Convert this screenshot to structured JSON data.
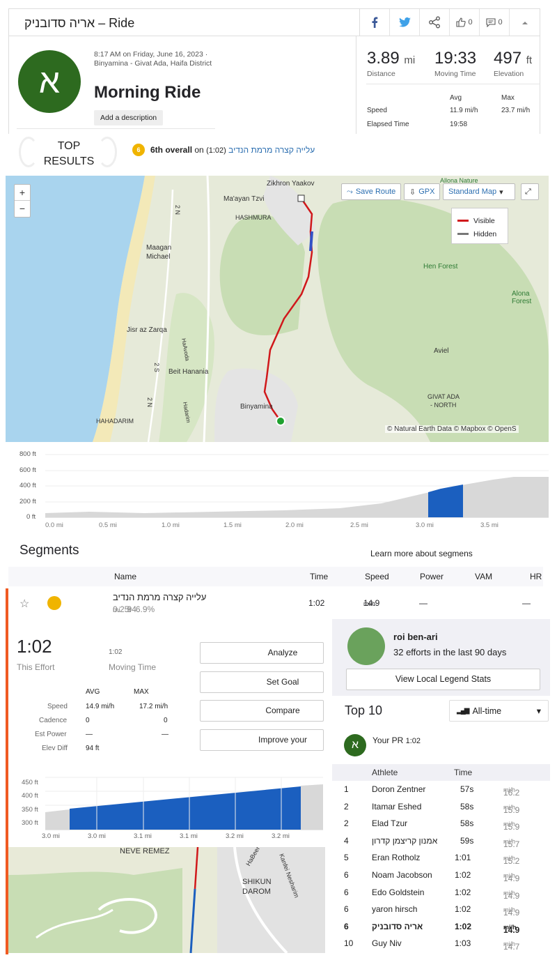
{
  "header": {
    "title": "אריה סדובניק – Ride",
    "kudos_count": "0",
    "comment_count": "0"
  },
  "activity": {
    "avatar_letter": "א",
    "datetime": "8:17 AM on Friday, June 16, 2023 ·",
    "location": "Binyamina - Givat Ada, Haifa District",
    "name": "Morning Ride",
    "add_description": "Add a description"
  },
  "stats": {
    "distance": {
      "value": "3.89",
      "unit": "mi",
      "label": "Distance"
    },
    "moving_time": {
      "value": "19:33",
      "label": "Moving Time"
    },
    "elevation": {
      "value": "497",
      "unit": "ft",
      "label": "Elevation"
    },
    "avg_label": "Avg",
    "max_label": "Max",
    "speed_label": "Speed",
    "speed_avg": "11.9 mi/h",
    "speed_max": "23.7 mi/h",
    "elapsed_label": "Elapsed Time",
    "elapsed": "19:58"
  },
  "top_results": {
    "badge": "TOP RESULTS",
    "rank_icon": "6",
    "text": "6th overall",
    "on": "on",
    "segment": "עלייה קצרה מרמת הנדיב",
    "time": "(1:02)"
  },
  "map": {
    "zoom_in": "+",
    "zoom_out": "−",
    "save_route": "Save Route",
    "gpx": "GPX",
    "map_type": "Standard Map",
    "legend_visible": "Visible",
    "legend_hidden": "Hidden",
    "attribution": "© Natural Earth Data © Mapbox © OpenS",
    "places": [
      "Zikhron Yaakov",
      "Ma'ayan Tzvi",
      "HASHMURA",
      "Maagan",
      "Michael",
      "Jisr az Zarqa",
      "Beit Hanania",
      "Binyamina",
      "HAHADARIM",
      "Hen Forest",
      "Alona Forest",
      "Aviel",
      "GIVAT ADA",
      "- NORTH",
      "Allona Nature",
      "2 N",
      "2 S",
      "2 N",
      "Hadarim",
      "HaAvoda"
    ],
    "colors": {
      "visible": "#d0181b",
      "hidden": "#777777",
      "segment": "#3351c6",
      "water": "#a9d4ee",
      "green": "#c8ddb4"
    }
  },
  "elevation_chart": {
    "y_ticks": [
      "800 ft",
      "600 ft",
      "400 ft",
      "200 ft",
      "0 ft"
    ],
    "x_ticks": [
      "0.0 mi",
      "0.5 mi",
      "1.0 mi",
      "1.5 mi",
      "2.0 mi",
      "2.5 mi",
      "3.0 mi",
      "3.5 mi"
    ]
  },
  "segments": {
    "title": "Segments",
    "learn_more": "Learn more about segmens",
    "columns": [
      "Name",
      "Time",
      "Speed",
      "Power",
      "VAM",
      "HR"
    ],
    "row": {
      "name": "עלייה קצרה מרמת הנדיב",
      "distance": "0.25",
      "distance_unit": "mi",
      "elev": "94",
      "elev_unit": "ft",
      "grade": "6.9%",
      "time": "1:02",
      "speed": "14.9",
      "speed_unit": "mi/h",
      "power": "—",
      "hr": "—"
    }
  },
  "effort": {
    "time": "1:02",
    "label": "This Effort",
    "moving_time": "1:02",
    "moving_label": "Moving Time",
    "avg": "AVG",
    "max": "MAX",
    "rows": [
      {
        "label": "Speed",
        "avg": "14.9 mi/h",
        "max": "17.2 mi/h"
      },
      {
        "label": "Cadence",
        "avg": "0",
        "max": "0"
      },
      {
        "label": "Est Power",
        "avg": "—",
        "max": "—"
      },
      {
        "label": "Elev Diff",
        "avg": "94 ft",
        "max": ""
      }
    ],
    "buttons": [
      "Analyze",
      "Set Goal",
      "Compare",
      "Improve your"
    ],
    "chart": {
      "y_ticks": [
        "450 ft",
        "400 ft",
        "350 ft",
        "300 ft"
      ],
      "x_ticks": [
        "3.0 mi",
        "3.0 mi",
        "3.1 mi",
        "3.1 mi",
        "3.2 mi",
        "3.2 mi"
      ]
    },
    "map_places": [
      "NEVE REMEZ",
      "HaBeer",
      "Kanfei Nesharim",
      "SHIKUN",
      "DAROM"
    ]
  },
  "local_legend": {
    "name": "roi ben-ari",
    "efforts": "32 efforts in the last 90 days",
    "button": "View Local Legend Stats"
  },
  "top10": {
    "title": "Top 10",
    "filter": "All-time",
    "pr_label": "Your PR",
    "pr_time": "1:02",
    "col_athlete": "Athlete",
    "col_time": "Time",
    "rows": [
      {
        "rank": "1",
        "name": "Doron Zentner",
        "time": "57s",
        "speed": "16.2",
        "unit": "mi/h"
      },
      {
        "rank": "2",
        "name": "Itamar Eshed",
        "time": "58s",
        "speed": "15.9",
        "unit": "mi/h"
      },
      {
        "rank": "2",
        "name": "Elad Tzur",
        "time": "58s",
        "speed": "15.9",
        "unit": "mi/h"
      },
      {
        "rank": "4",
        "name": "אמנון קריצמן קדרון",
        "time": "59s",
        "speed": "15.7",
        "unit": "mi/h"
      },
      {
        "rank": "5",
        "name": "Eran Rotholz",
        "time": "1:01",
        "speed": "15.2",
        "unit": "mi/h"
      },
      {
        "rank": "6",
        "name": "Noam Jacobson",
        "time": "1:02",
        "speed": "14.9",
        "unit": "mi/h"
      },
      {
        "rank": "6",
        "name": "Edo Goldstein",
        "time": "1:02",
        "speed": "14.9",
        "unit": "mi/h"
      },
      {
        "rank": "6",
        "name": "yaron hirsch",
        "time": "1:02",
        "speed": "14.9",
        "unit": "mi/h"
      },
      {
        "rank": "6",
        "name": "אריה סדובניק",
        "time": "1:02",
        "speed": "14.9",
        "unit": "mi/h",
        "bold": true
      },
      {
        "rank": "10",
        "name": "Guy Niv",
        "time": "1:03",
        "speed": "14.7",
        "unit": "mi/h"
      }
    ]
  }
}
